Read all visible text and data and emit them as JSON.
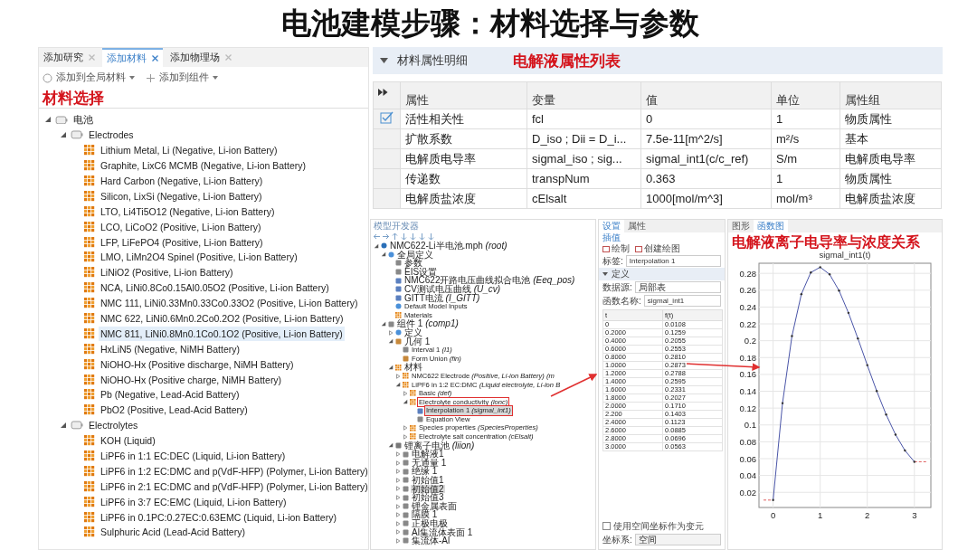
{
  "title": "电池建模步骤：材料选择与参数",
  "material_browser": {
    "tabs": [
      {
        "label": "添加研究",
        "selected": false
      },
      {
        "label": "添加材料",
        "selected": true
      },
      {
        "label": "添加物理场",
        "selected": false
      }
    ],
    "toolbar": [
      "添加到全局材料",
      "添加到组件"
    ],
    "annotation": "材料选择",
    "tree": [
      {
        "label": "电池",
        "kind": "folder",
        "expanded": true,
        "selected": false,
        "children": [
          {
            "label": "Electrodes",
            "kind": "folder",
            "expanded": true,
            "selected": false,
            "children": [
              {
                "label": "Lithium Metal, Li (Negative, Li-ion Battery)",
                "kind": "material",
                "selected": false
              },
              {
                "label": "Graphite, LixC6 MCMB (Negative, Li-ion Battery)",
                "kind": "material",
                "selected": false
              },
              {
                "label": "Hard Carbon (Negative, Li-ion Battery)",
                "kind": "material",
                "selected": false
              },
              {
                "label": "Silicon, LixSi (Negative, Li-ion Battery)",
                "kind": "material",
                "selected": false
              },
              {
                "label": "LTO, Li4Ti5O12 (Negative, Li-ion Battery)",
                "kind": "material",
                "selected": false
              },
              {
                "label": "LCO, LiCoO2 (Positive, Li-ion Battery)",
                "kind": "material",
                "selected": false
              },
              {
                "label": "LFP, LiFePO4 (Positive, Li-ion Battery)",
                "kind": "material",
                "selected": false
              },
              {
                "label": "LMO, LiMn2O4 Spinel (Positive, Li-ion Battery)",
                "kind": "material",
                "selected": false
              },
              {
                "label": "LiNiO2 (Positive, Li-ion Battery)",
                "kind": "material",
                "selected": false
              },
              {
                "label": "NCA, LiNi0.8Co0.15Al0.05O2 (Positive, Li-ion Battery)",
                "kind": "material",
                "selected": false
              },
              {
                "label": "NMC 111, LiNi0.33Mn0.33Co0.33O2 (Positive, Li-ion Battery)",
                "kind": "material",
                "selected": false
              },
              {
                "label": "NMC 622, LiNi0.6Mn0.2Co0.2O2 (Positive, Li-ion Battery)",
                "kind": "material",
                "selected": false
              },
              {
                "label": "NMC 811, LiNi0.8Mn0.1Co0.1O2 (Positive, Li-ion Battery)",
                "kind": "material",
                "selected": true
              },
              {
                "label": "HxLiN5 (Negative, NiMH Battery)",
                "kind": "material",
                "selected": false
              },
              {
                "label": "NiOHO-Hx (Positive discharge, NiMH Battery)",
                "kind": "material",
                "selected": false
              },
              {
                "label": "NiOHO-Hx (Positive charge, NiMH Battery)",
                "kind": "material",
                "selected": false
              },
              {
                "label": "Pb (Negative, Lead-Acid Battery)",
                "kind": "material",
                "selected": false
              },
              {
                "label": "PbO2 (Positive, Lead-Acid Battery)",
                "kind": "material",
                "selected": false
              }
            ]
          },
          {
            "label": "Electrolytes",
            "kind": "folder",
            "expanded": true,
            "selected": false,
            "children": [
              {
                "label": "KOH (Liquid)",
                "kind": "material",
                "selected": false
              },
              {
                "label": "LiPF6 in 1:1 EC:DEC (Liquid, Li-ion Battery)",
                "kind": "material",
                "selected": false
              },
              {
                "label": "LiPF6 in 1:2 EC:DMC and p(VdF-HFP) (Polymer, Li-ion Battery)",
                "kind": "material",
                "selected": false
              },
              {
                "label": "LiPF6 in 2:1 EC:DMC and p(VdF-HFP) (Polymer, Li-ion Battery)",
                "kind": "material",
                "selected": false
              },
              {
                "label": "LiPF6 in 3:7 EC:EMC (Liquid, Li-ion Battery)",
                "kind": "material",
                "selected": false
              },
              {
                "label": "LiPF6 in 0.1PC:0.27EC:0.63EMC (Liquid, Li-ion Battery)",
                "kind": "material",
                "selected": false
              },
              {
                "label": "Sulphuric Acid (Lead-Acid Battery)",
                "kind": "material",
                "selected": false
              }
            ]
          }
        ]
      }
    ]
  },
  "properties": {
    "header": "材料属性明细",
    "expanded": true,
    "annotation": "电解液属性列表",
    "columns": [
      "属性",
      "变量",
      "值",
      "单位",
      "属性组"
    ],
    "rows": [
      {
        "checked": true,
        "cells": [
          "活性相关性",
          "fcl",
          "0",
          "1",
          "物质属性"
        ]
      },
      {
        "checked": false,
        "cells": [
          "扩散系数",
          "D_iso ; Dii = D_i...",
          "7.5e-11[m^2/s]",
          "m²/s",
          "基本"
        ]
      },
      {
        "checked": false,
        "cells": [
          "电解质电导率",
          "sigmal_iso ; sig...",
          "sigmal_int1(c/c_ref)",
          "S/m",
          "电解质电导率"
        ]
      },
      {
        "checked": false,
        "cells": [
          "传递数",
          "transpNum",
          "0.363",
          "1",
          "物质属性"
        ]
      },
      {
        "checked": false,
        "cells": [
          "电解质盐浓度",
          "cElsalt",
          "1000[mol/m^3]",
          "mol/m³",
          "电解质盐浓度"
        ]
      }
    ]
  },
  "model_builder": {
    "title": "模型开发器",
    "tree": [
      {
        "label": "NMC622-Li半电池.mph",
        "tag": "(root)",
        "kind": "root",
        "expanded": true,
        "selected": false,
        "children": [
          {
            "label": "全局定义",
            "kind": "global",
            "expanded": true,
            "selected": false,
            "children": [
              {
                "label": "参数",
                "kind": "item",
                "selected": false
              },
              {
                "label": "EIS设置",
                "kind": "item",
                "selected": false
              },
              {
                "label": "NMC622开路电压曲线拟合电池",
                "tag": "(Eeq_pos)",
                "kind": "function",
                "selected": false
              },
              {
                "label": "CV测试电压曲线",
                "tag": "(U_cv)",
                "kind": "function",
                "selected": false
              },
              {
                "label": "GITT电流",
                "tag": "(I_GITT)",
                "kind": "function",
                "selected": false
              },
              {
                "label": "Default Model Inputs",
                "kind": "global",
                "selected": false
              },
              {
                "label": "Materials",
                "kind": "material",
                "selected": false
              }
            ]
          },
          {
            "label": "组件 1",
            "tag": "(comp1)",
            "kind": "item",
            "expanded": true,
            "selected": false,
            "children": [
              {
                "label": "定义",
                "kind": "global",
                "expanded": false,
                "selected": false
              },
              {
                "label": "几何 1",
                "kind": "geometry",
                "expanded": true,
                "selected": false,
                "children": [
                  {
                    "label": "Interval 1",
                    "tag": "(I1)",
                    "kind": "item",
                    "selected": false
                  },
                  {
                    "label": "Form Union",
                    "tag": "(fin)",
                    "kind": "geometry",
                    "selected": false
                  }
                ]
              },
              {
                "label": "材料",
                "kind": "material",
                "expanded": true,
                "selected": false,
                "children": [
                  {
                    "label": "NMC622 Electrode",
                    "tag": "(Positive, Li-ion Battery) (m",
                    "kind": "material",
                    "expanded": false,
                    "selected": false
                  },
                  {
                    "label": "LiPF6 in 1:2 EC:DMC",
                    "tag": "(Liquid electrolyte, Li-ion B",
                    "kind": "material",
                    "expanded": true,
                    "selected": false,
                    "children": [
                      {
                        "label": "Basic",
                        "tag": "(def)",
                        "kind": "material",
                        "expanded": false,
                        "selected": false
                      },
                      {
                        "label": "Electrolyte conductivity",
                        "tag": "(ionc)",
                        "kind": "material",
                        "expanded": true,
                        "selected": false,
                        "callout": true,
                        "children": [
                          {
                            "label": "Interpolation 1",
                            "tag": "(sigmal_int1)",
                            "kind": "function",
                            "selected": true,
                            "callout": true
                          },
                          {
                            "label": "Equation View",
                            "kind": "item",
                            "selected": false
                          }
                        ]
                      },
                      {
                        "label": "Species properties",
                        "tag": "(SpeciesProperties)",
                        "kind": "material",
                        "expanded": false,
                        "selected": false
                      },
                      {
                        "label": "Electrolyte salt concentration",
                        "tag": "(cElsalt)",
                        "kind": "material",
                        "expanded": false,
                        "selected": false
                      }
                    ]
                  }
                ]
              },
              {
                "label": "锂离子电池",
                "tag": "(liion)",
                "kind": "physics",
                "expanded": true,
                "selected": false,
                "children": [
                  {
                    "label": "电解液1",
                    "kind": "item",
                    "expanded": false,
                    "selected": false
                  },
                  {
                    "label": "无通量 1",
                    "kind": "item",
                    "expanded": false,
                    "selected": false
                  },
                  {
                    "label": "绝缘 1",
                    "kind": "item",
                    "expanded": false,
                    "selected": false
                  },
                  {
                    "label": "初始值1",
                    "kind": "item",
                    "expanded": false,
                    "selected": false
                  },
                  {
                    "label": "初始值2",
                    "kind": "item",
                    "expanded": false,
                    "selected": true
                  },
                  {
                    "label": "初始值3",
                    "kind": "item",
                    "expanded": false,
                    "selected": false
                  },
                  {
                    "label": "锂金属表面",
                    "kind": "item",
                    "expanded": false,
                    "selected": false
                  },
                  {
                    "label": "隔膜 1",
                    "kind": "item",
                    "expanded": false,
                    "selected": false
                  },
                  {
                    "label": "正极电极",
                    "kind": "item",
                    "expanded": false,
                    "selected": false
                  },
                  {
                    "label": "Al集流体表面 1",
                    "kind": "item",
                    "expanded": false,
                    "selected": false
                  },
                  {
                    "label": "集流体-Al",
                    "kind": "item",
                    "expanded": false,
                    "selected": false
                  }
                ]
              }
            ]
          }
        ]
      }
    ]
  },
  "settings": {
    "tabs": [
      {
        "label": "设置",
        "selected": true
      },
      {
        "label": "属性",
        "selected": false
      }
    ],
    "heading": "插值",
    "actions": [
      "绘制",
      "创建绘图"
    ],
    "label_field": {
      "label": "标签:",
      "value": "Interpolation 1"
    },
    "section": {
      "label": "定义",
      "expanded": true
    },
    "data_source": {
      "label": "数据源:",
      "value": "局部表"
    },
    "function_name": {
      "label": "函数名称:",
      "value": "sigmal_int1"
    },
    "table": {
      "columns": [
        "t",
        "f(t)"
      ],
      "rows": [
        [
          "0",
          "0.0108"
        ],
        [
          "0.2000",
          "0.1259"
        ],
        [
          "0.4000",
          "0.2055"
        ],
        [
          "0.6000",
          "0.2553"
        ],
        [
          "0.8000",
          "0.2810"
        ],
        [
          "1.0000",
          "0.2873"
        ],
        [
          "1.2000",
          "0.2788"
        ],
        [
          "1.4000",
          "0.2595"
        ],
        [
          "1.6000",
          "0.2331"
        ],
        [
          "1.8000",
          "0.2027"
        ],
        [
          "2.0000",
          "0.1710"
        ],
        [
          "2.200",
          "0.1403"
        ],
        [
          "2.4000",
          "0.1123"
        ],
        [
          "2.6000",
          "0.0885"
        ],
        [
          "2.8000",
          "0.0696"
        ],
        [
          "3.0000",
          "0.0563"
        ]
      ]
    },
    "use_space_coords": {
      "label": "使用空间坐标作为变元",
      "checked": false
    },
    "coord_system": {
      "label": "坐标系:",
      "value": "空间"
    }
  },
  "graphics": {
    "tabs": [
      {
        "label": "图形",
        "selected": false
      },
      {
        "label": "函数图",
        "selected": true
      }
    ],
    "annotation": "电解液离子电导率与浓度关系",
    "chart_data": {
      "type": "line",
      "title": "sigmal_int1(t)",
      "x": [
        0,
        0.2,
        0.4,
        0.6,
        0.8,
        1.0,
        1.2,
        1.4,
        1.6,
        1.8,
        2.0,
        2.2,
        2.4,
        2.6,
        2.8,
        3.0
      ],
      "grid": true,
      "series": [
        {
          "color": "#4a55a8",
          "values": [
            0.0108,
            0.1259,
            0.2055,
            0.2553,
            0.281,
            0.2873,
            0.2788,
            0.2595,
            0.2331,
            0.2027,
            0.171,
            0.1403,
            0.1123,
            0.0885,
            0.0696,
            0.0563
          ]
        }
      ],
      "xlim": [
        -0.3,
        3.35
      ],
      "ylim": [
        0.002,
        0.292
      ],
      "xticks": [
        0,
        1,
        2,
        3
      ],
      "yticks": [
        {
          "value": 0.02,
          "label": "0.02"
        },
        {
          "value": 0.04,
          "label": "0.04"
        },
        {
          "value": 0.06,
          "label": "0.06"
        },
        {
          "value": 0.08,
          "label": "0.08"
        },
        {
          "value": 0.1,
          "label": "0.1"
        },
        {
          "value": 0.12,
          "label": "0.12"
        },
        {
          "value": 0.14,
          "label": "0.14"
        },
        {
          "value": 0.16,
          "label": "0.16"
        },
        {
          "value": 0.18,
          "label": "0.18"
        },
        {
          "value": 0.2,
          "label": "0.2"
        },
        {
          "value": 0.22,
          "label": "0.22"
        },
        {
          "value": 0.24,
          "label": "0.24"
        },
        {
          "value": 0.26,
          "label": "0.26"
        },
        {
          "value": 0.28,
          "label": "0.28"
        }
      ]
    }
  }
}
